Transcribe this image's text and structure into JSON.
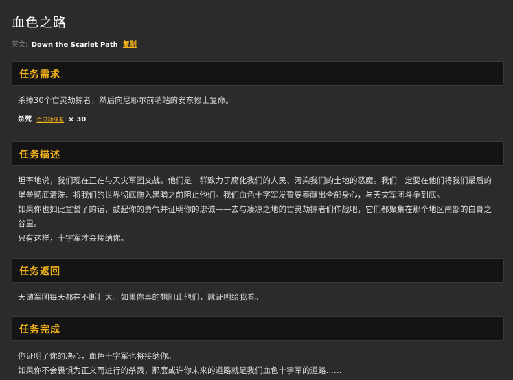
{
  "quest": {
    "title": "血色之路",
    "english_label": "英文:",
    "english_name": "Down the Scarlet Path",
    "copy_label": "复制"
  },
  "requirements": {
    "header": "任务需求",
    "text": "杀掉30个亡灵劫掠者，然后向尼耶尔前哨站的安东修士复命。",
    "kill_label": "杀死",
    "npc_name": "亡灵劫掠者",
    "count": "× 30"
  },
  "description": {
    "header": "任务描述",
    "lines": [
      "坦率地说，我们现在正在与天灾军团交战。他们是一群致力于腐化我们的人民、污染我们的土地的恶魔。我们一定要在他们将我们最后的堡垒彻底清洗、将我们的世界彻底拖入黑暗之前阻止他们。我们血色十字军发誓要奉献出全部身心，与天灾军团斗争到底。",
      "如果你也如此宣誓了的话，鼓起你的勇气并证明你的忠诚——去与凄凉之地的亡灵劫掠者们作战吧，它们都聚集在那个地区南部的白骨之谷里。",
      "只有这样，十字军才会接纳你。"
    ]
  },
  "return": {
    "header": "任务返回",
    "text": "天谴军团每天都在不断壮大。如果你真的想阻止他们，就证明给我看。"
  },
  "completion": {
    "header": "任务完成",
    "lines": [
      "你证明了你的决心，血色十字军也将接纳你。",
      "如果你不会畏惧为正义而进行的杀戮，那麽或许你未来的道路就是我们血色十字军的道路……"
    ]
  }
}
